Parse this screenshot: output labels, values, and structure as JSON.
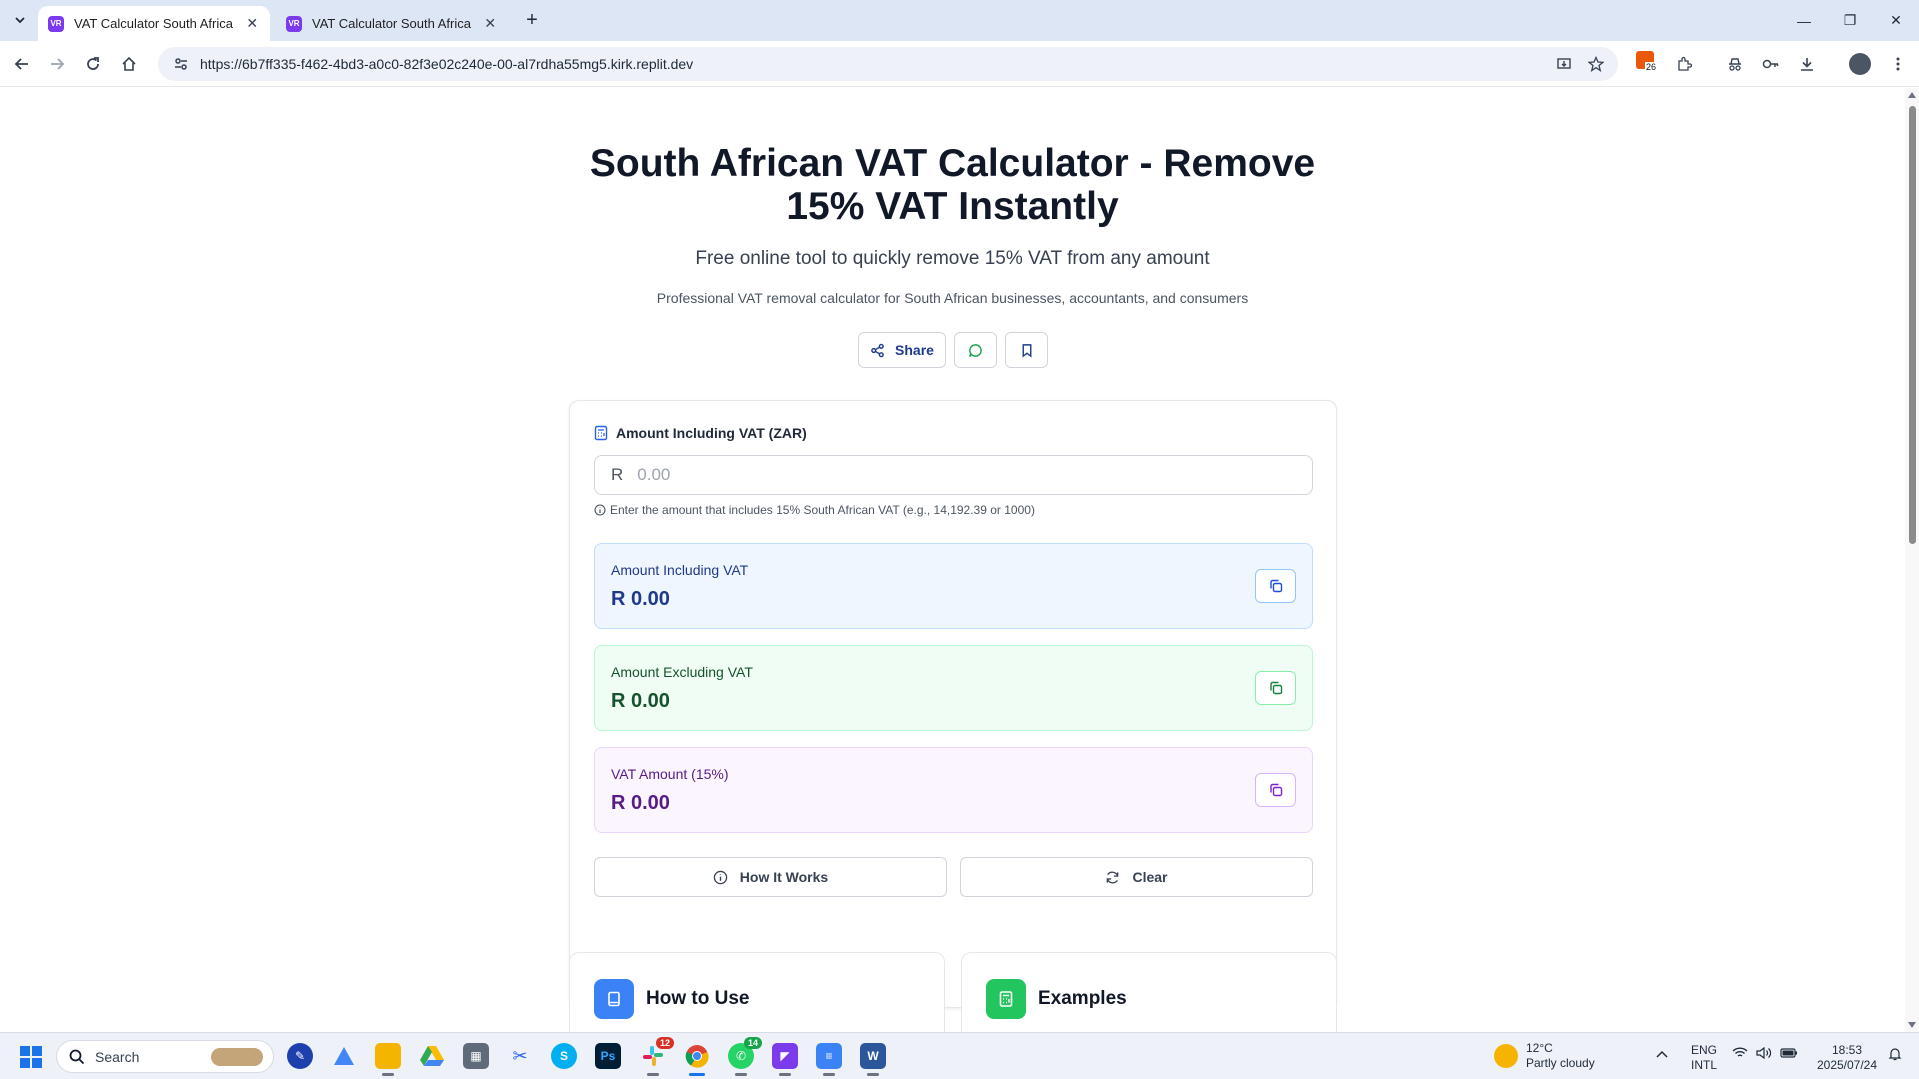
{
  "browser": {
    "tabs": [
      {
        "favicon": "VR",
        "title": "VAT Calculator South Africa - Re",
        "active": true
      },
      {
        "favicon": "VR",
        "title": "VAT Calculator South Africa - Re",
        "active": false
      }
    ],
    "url": "https://6b7ff335-f462-4bd3-a0c0-82f3e02c240e-00-al7rdha55mg5.kirk.replit.dev",
    "extension_badge": "26"
  },
  "page": {
    "title": "South African VAT Calculator - Remove 15% VAT Instantly",
    "subtitle": "Free online tool to quickly remove 15% VAT from any amount",
    "description": "Professional VAT removal calculator for South African businesses, accountants, and consumers",
    "share_label": "Share"
  },
  "calculator": {
    "input_label": "Amount Including VAT (ZAR)",
    "currency_prefix": "R",
    "input_placeholder": "0.00",
    "hint": "Enter the amount that includes 15% South African VAT (e.g., 14,192.39 or 1000)",
    "results": {
      "including": {
        "label": "Amount Including VAT",
        "value": "R 0.00"
      },
      "excluding": {
        "label": "Amount Excluding VAT",
        "value": "R 0.00"
      },
      "vat": {
        "label": "VAT Amount (15%)",
        "value": "R 0.00"
      }
    },
    "how_it_works_label": "How It Works",
    "clear_label": "Clear"
  },
  "sections": {
    "how_to_use": "How to Use",
    "examples": "Examples"
  },
  "taskbar": {
    "search_label": "Search",
    "slack_badge": "12",
    "whatsapp_badge": "14",
    "weather_temp": "12°C",
    "weather_desc": "Partly cloudy",
    "lang_1": "ENG",
    "lang_2": "INTL",
    "time": "18:53",
    "date": "2025/07/24"
  },
  "colors": {
    "blue_accent": "#1e3a8a",
    "green_accent": "#14532d",
    "purple_accent": "#581c87",
    "how_to_use_icon_bg": "#3b82f6",
    "examples_icon_bg": "#22c55e"
  }
}
